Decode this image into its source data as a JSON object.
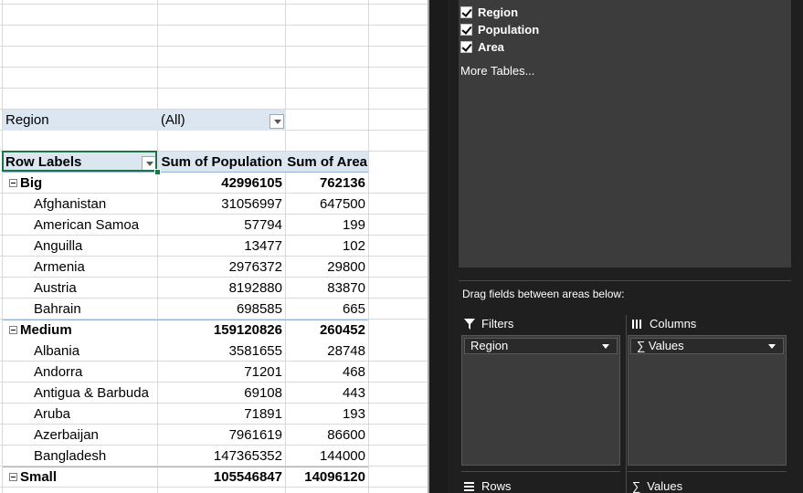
{
  "pivot": {
    "filter": {
      "label": "Region",
      "value": "(All)"
    },
    "headers": {
      "row_labels": "Row Labels",
      "sum_population": "Sum of Population",
      "sum_area": "Sum of Area"
    },
    "groups": [
      {
        "label": "Big",
        "population": "42996105",
        "area": "762136",
        "rows": [
          {
            "name": "Afghanistan",
            "population": "31056997",
            "area": "647500"
          },
          {
            "name": "American Samoa",
            "population": "57794",
            "area": "199"
          },
          {
            "name": "Anguilla",
            "population": "13477",
            "area": "102"
          },
          {
            "name": "Armenia",
            "population": "2976372",
            "area": "29800"
          },
          {
            "name": "Austria",
            "population": "8192880",
            "area": "83870"
          },
          {
            "name": "Bahrain",
            "population": "698585",
            "area": "665"
          }
        ]
      },
      {
        "label": "Medium",
        "population": "159120826",
        "area": "260452",
        "rows": [
          {
            "name": "Albania",
            "population": "3581655",
            "area": "28748"
          },
          {
            "name": "Andorra",
            "population": "71201",
            "area": "468"
          },
          {
            "name": "Antigua & Barbuda",
            "population": "69108",
            "area": "443"
          },
          {
            "name": "Aruba",
            "population": "71891",
            "area": "193"
          },
          {
            "name": "Azerbaijan",
            "population": "7961619",
            "area": "86600"
          },
          {
            "name": "Bangladesh",
            "population": "147365352",
            "area": "144000"
          }
        ]
      },
      {
        "label": "Small",
        "population": "105546847",
        "area": "14096120",
        "rows": []
      }
    ]
  },
  "field_list": {
    "fields": [
      "Region",
      "Population",
      "Area"
    ],
    "more_tables": "More Tables...",
    "drag_hint": "Drag fields between areas below:",
    "areas": {
      "filters": {
        "title": "Filters",
        "item": "Region"
      },
      "columns": {
        "title": "Columns",
        "item": "∑ Values"
      },
      "rows": {
        "title": "Rows"
      },
      "values": {
        "title": "Values"
      }
    }
  },
  "icons": {
    "filters": "filter-funnel-icon",
    "columns": "columns-icon",
    "rows": "rows-icon",
    "values": "sigma-icon"
  },
  "colors": {
    "pivot_header_fill": "#dce6f1",
    "pivot_header_border": "#95b3d7",
    "active_cell_border": "#217346",
    "pane_background": "#1f1f1f",
    "pane_box": "#3c3c3c"
  }
}
